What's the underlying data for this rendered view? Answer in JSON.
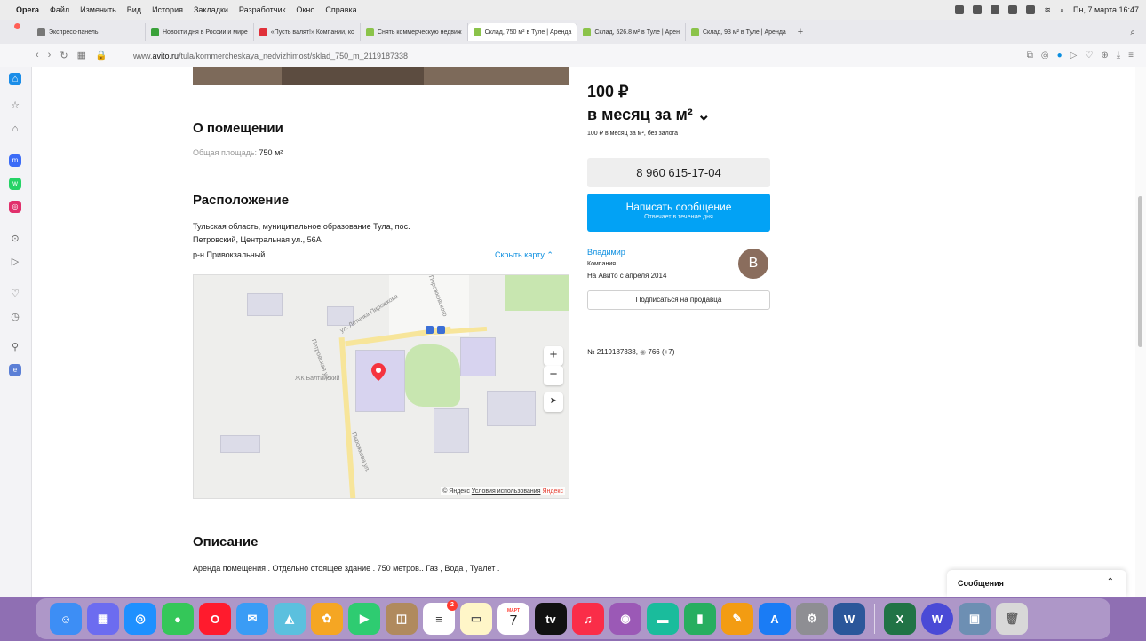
{
  "menubar": {
    "app": "Opera",
    "items": [
      "Файл",
      "Изменить",
      "Вид",
      "История",
      "Закладки",
      "Разработчик",
      "Окно",
      "Справка"
    ],
    "clock": "Пн, 7 марта 16:47"
  },
  "tabs": [
    {
      "label": "Экспресс-панель",
      "color": "#777777"
    },
    {
      "label": "Новости дня в России и мире",
      "color": "#3aa13a"
    },
    {
      "label": "«Пусть валят!» Компании, ко",
      "color": "#e0303a"
    },
    {
      "label": "Снять коммерческую недвиж",
      "color": "#8bc34a"
    },
    {
      "label": "Склад, 750 м² в Туле | Аренда",
      "color": "#8bc34a",
      "active": true
    },
    {
      "label": "Склад, 526.8 м² в Туле | Арен",
      "color": "#8bc34a"
    },
    {
      "label": "Склад, 93 м² в Туле | Аренда",
      "color": "#8bc34a"
    }
  ],
  "address": {
    "prefix": "www.",
    "domain": "avito.ru",
    "path": "/tula/kommercheskaya_nedvizhimost/sklad_750_m_2119187338"
  },
  "premises": {
    "heading": "О помещении",
    "area_label": "Общая площадь:",
    "area_value": "750 м²"
  },
  "location": {
    "heading": "Расположение",
    "address_line1": "Тульская область, муниципальное образование Тула, пос.",
    "address_line2": "Петровский, Центральная ул., 56А",
    "district": "р-н Привокзальный",
    "hide_map": "Скрыть карту ⌃"
  },
  "map": {
    "labels": {
      "street1": "ул. Лётчика Пирожкова",
      "street2": "Петровская ул.",
      "street3": "Пирожкова ул.",
      "complex": "ЖК Балтийский",
      "top_street": "Пирожковского"
    },
    "zoom_in": "+",
    "zoom_out": "−",
    "locate": "➤",
    "footer_copy": "© Яндекс",
    "footer_terms": "Условия использования",
    "footer_brand": "Яндекс"
  },
  "description": {
    "heading": "Описание",
    "text": "Аренда помещения . Отдельно стоящее здание . 750 метров.. Газ , Вода , Туалет ."
  },
  "offer": {
    "price": "100 ₽",
    "period": "в месяц за м² ⌄",
    "price_note": "100 ₽ в месяц за м², без залога",
    "phone": "8 960 615-17-04",
    "message_title": "Написать сообщение",
    "message_sub": "Отвечает в течение дня",
    "seller_name": "Владимир",
    "seller_type": "Компания",
    "seller_since": "На Авито с апреля 2014",
    "avatar_letter": "B",
    "subscribe": "Подписаться на продавца",
    "ad_number": "№ 2119187338,",
    "views": "766 (+7)"
  },
  "messages_panel": {
    "label": "Сообщения",
    "chevron": "⌃"
  },
  "sidebar_more": "···",
  "dock": {
    "calendar_month": "МАРТ",
    "calendar_day": "7",
    "reminders_badge": "2"
  }
}
